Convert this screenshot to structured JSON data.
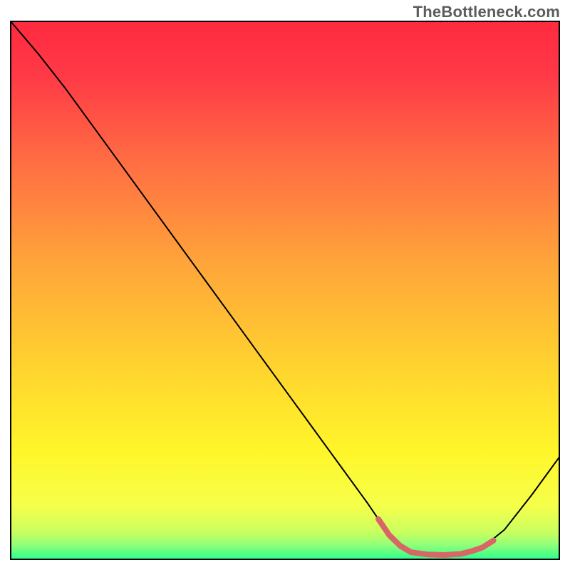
{
  "watermark": "TheBottleneck.com",
  "chart_data": {
    "type": "line",
    "title": "",
    "xlabel": "",
    "ylabel": "",
    "xlim": [
      0,
      100
    ],
    "ylim": [
      0,
      100
    ],
    "grid": false,
    "legend": false,
    "gradient_stops": [
      {
        "offset": 0.0,
        "color": "#ff2a3f"
      },
      {
        "offset": 0.1,
        "color": "#ff3946"
      },
      {
        "offset": 0.25,
        "color": "#ff6a43"
      },
      {
        "offset": 0.45,
        "color": "#ffa53a"
      },
      {
        "offset": 0.65,
        "color": "#ffd52e"
      },
      {
        "offset": 0.8,
        "color": "#fff62a"
      },
      {
        "offset": 0.9,
        "color": "#f6ff4a"
      },
      {
        "offset": 0.95,
        "color": "#c9ff60"
      },
      {
        "offset": 0.975,
        "color": "#8bff7a"
      },
      {
        "offset": 1.0,
        "color": "#2bff8d"
      }
    ],
    "series": [
      {
        "name": "black-curve",
        "color": "#000000",
        "width": 2,
        "points": [
          {
            "x": 0.0,
            "y": 100.0
          },
          {
            "x": 5.0,
            "y": 94.0
          },
          {
            "x": 10.0,
            "y": 87.5
          },
          {
            "x": 15.0,
            "y": 80.5
          },
          {
            "x": 20.0,
            "y": 73.5
          },
          {
            "x": 25.0,
            "y": 66.5
          },
          {
            "x": 30.0,
            "y": 59.5
          },
          {
            "x": 35.0,
            "y": 52.5
          },
          {
            "x": 40.0,
            "y": 45.5
          },
          {
            "x": 45.0,
            "y": 38.5
          },
          {
            "x": 50.0,
            "y": 31.5
          },
          {
            "x": 55.0,
            "y": 24.5
          },
          {
            "x": 60.0,
            "y": 17.5
          },
          {
            "x": 65.0,
            "y": 10.5
          },
          {
            "x": 68.0,
            "y": 6.0
          },
          {
            "x": 71.0,
            "y": 2.5
          },
          {
            "x": 74.0,
            "y": 1.0
          },
          {
            "x": 78.0,
            "y": 0.8
          },
          {
            "x": 82.0,
            "y": 1.0
          },
          {
            "x": 86.0,
            "y": 2.2
          },
          {
            "x": 90.0,
            "y": 5.5
          },
          {
            "x": 95.0,
            "y": 12.0
          },
          {
            "x": 100.0,
            "y": 19.0
          }
        ]
      },
      {
        "name": "highlight-marker",
        "color": "#d96666",
        "width": 8,
        "linecap": "round",
        "points": [
          {
            "x": 67.0,
            "y": 7.5
          },
          {
            "x": 69.0,
            "y": 4.5
          },
          {
            "x": 71.0,
            "y": 2.5
          },
          {
            "x": 73.0,
            "y": 1.3
          },
          {
            "x": 76.0,
            "y": 0.9
          },
          {
            "x": 79.0,
            "y": 0.8
          },
          {
            "x": 82.0,
            "y": 1.0
          },
          {
            "x": 84.0,
            "y": 1.5
          },
          {
            "x": 86.0,
            "y": 2.2
          },
          {
            "x": 88.0,
            "y": 3.5
          }
        ]
      }
    ]
  }
}
